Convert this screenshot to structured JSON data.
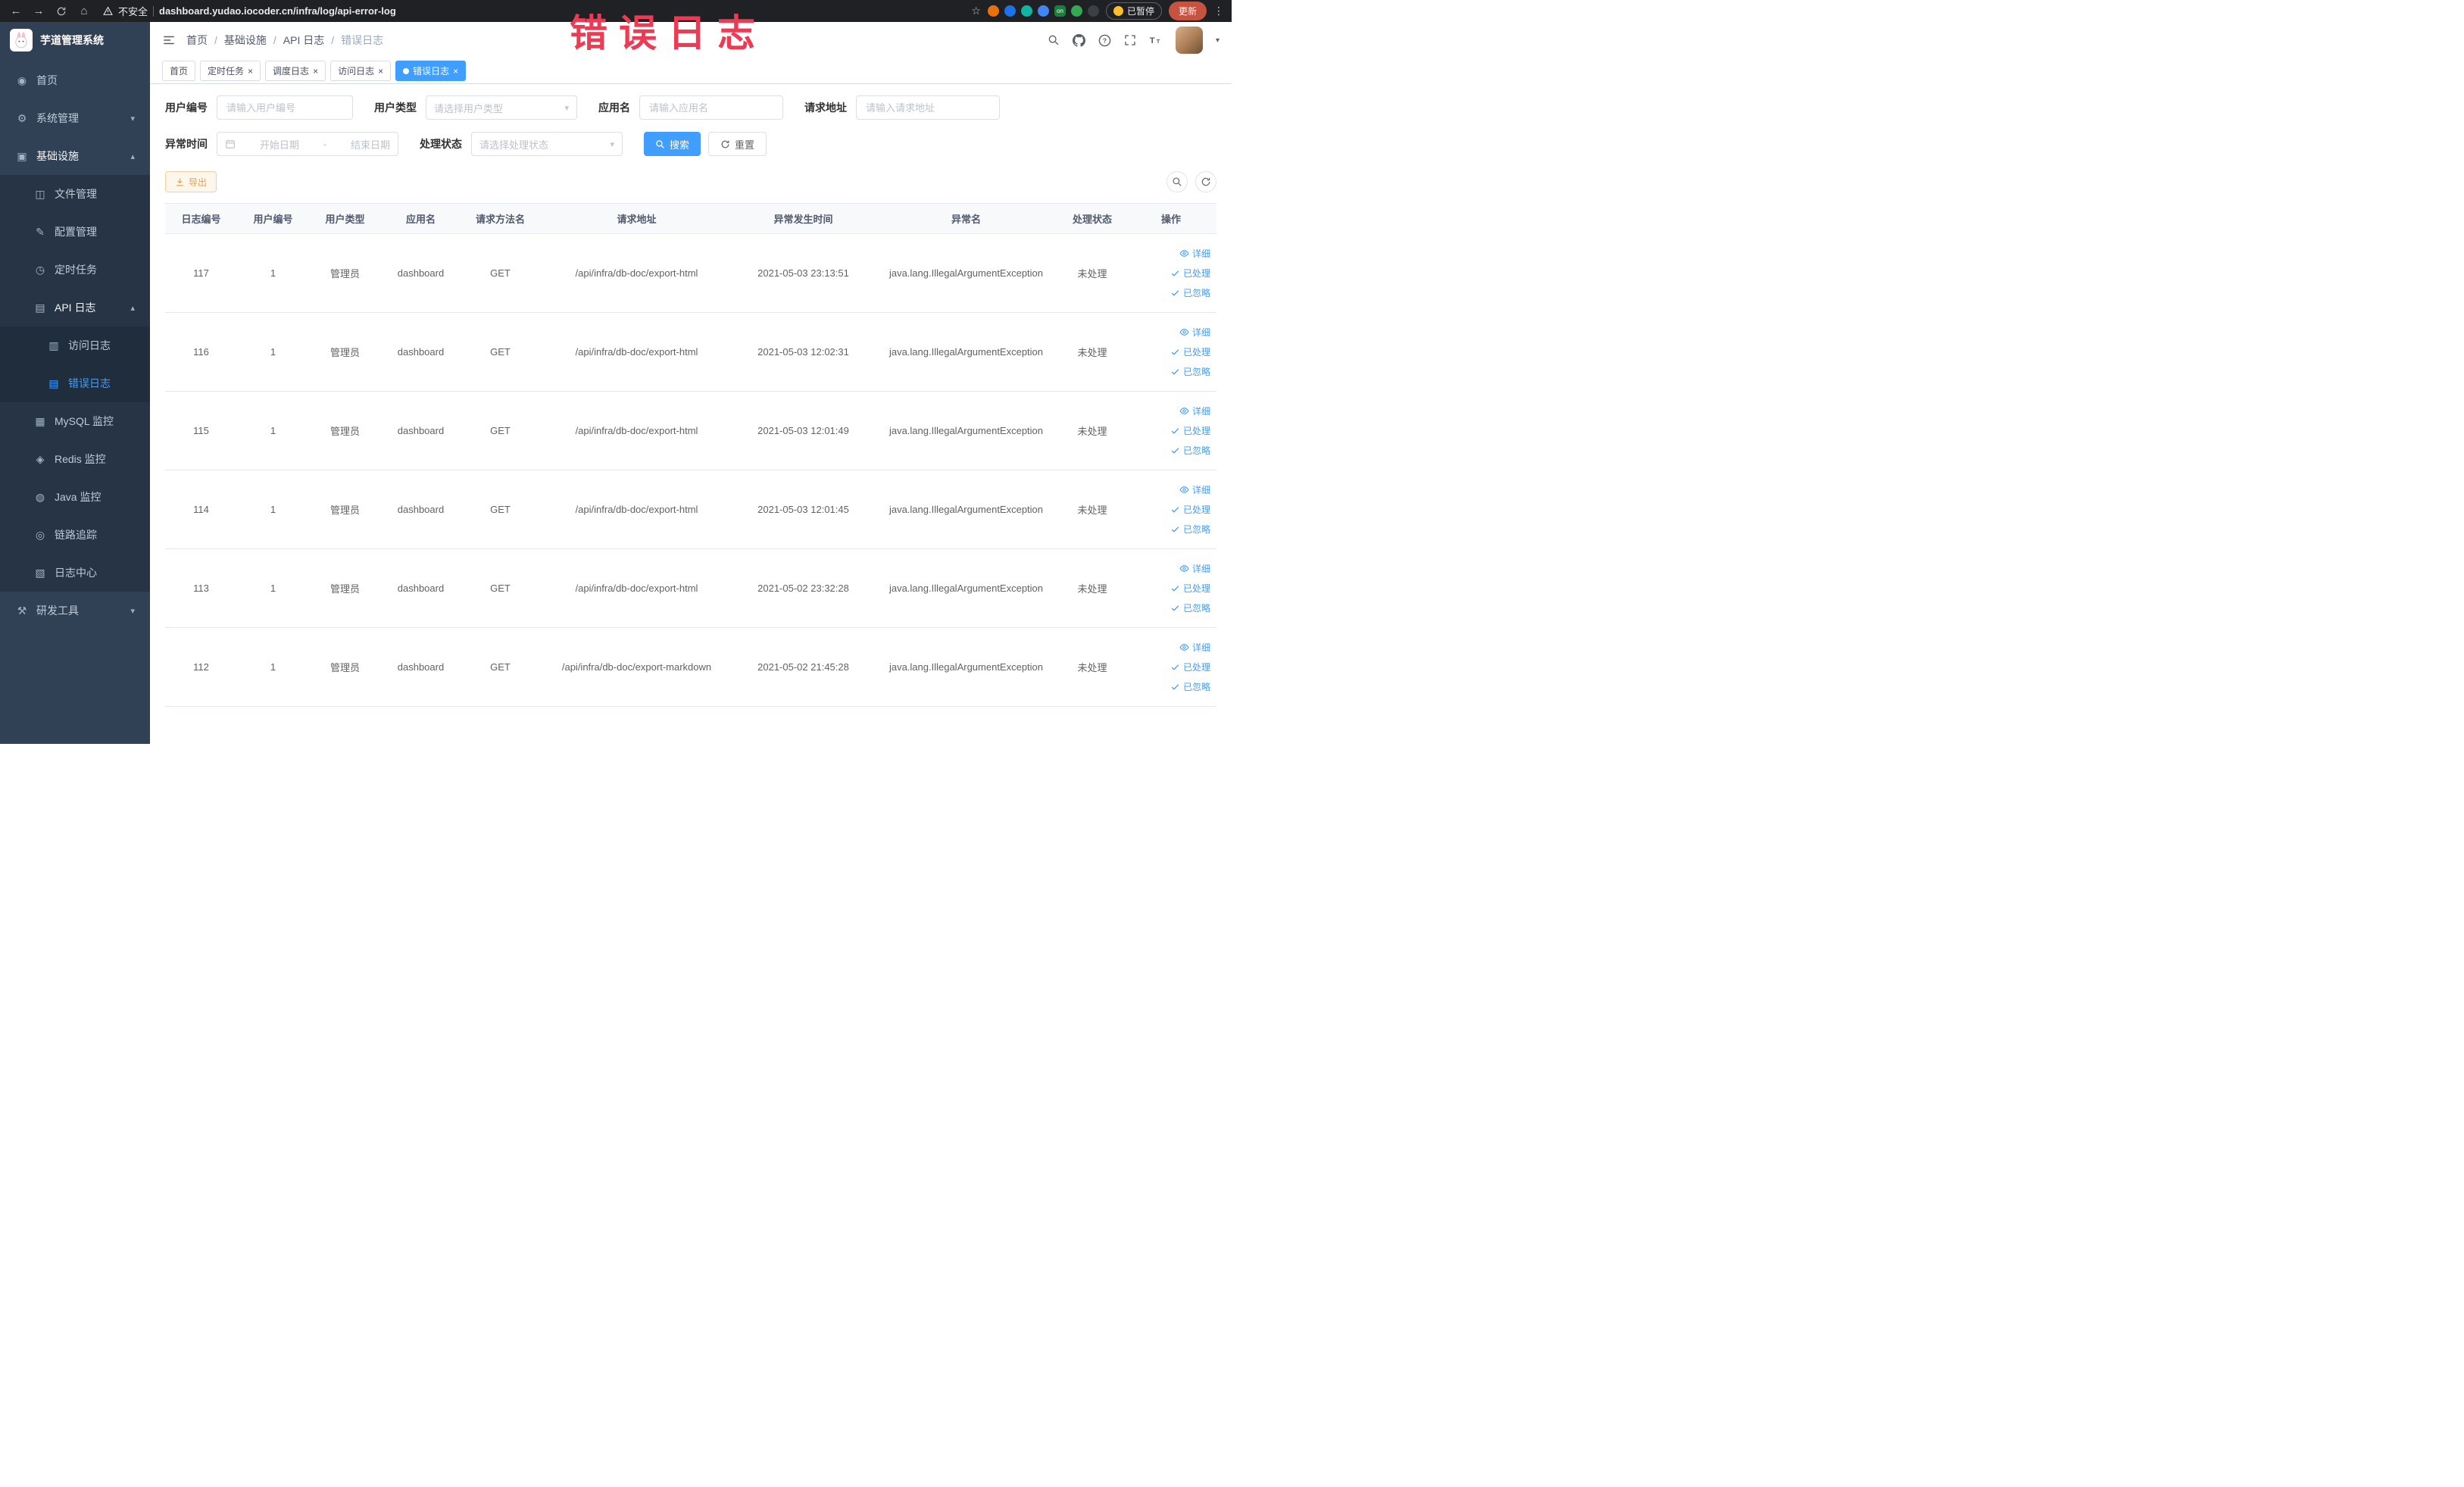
{
  "annotation": {
    "text": "错误日志"
  },
  "browser": {
    "security_label": "不安全",
    "url": "dashboard.yudao.iocoder.cn/infra/log/api-error-log",
    "paused_label": "已暂停",
    "update_label": "更新",
    "extensions": [
      {
        "name": "extension-orange-icon",
        "color": "#e8710a",
        "label": ""
      },
      {
        "name": "extension-blue-icon",
        "color": "#1a73e8",
        "label": ""
      },
      {
        "name": "extension-teal-icon",
        "color": "#12b5a5",
        "label": ""
      },
      {
        "name": "extension-grid-icon",
        "color": "#4285f4",
        "label": ""
      },
      {
        "name": "extension-on-icon",
        "color": "#188038",
        "label": "on"
      },
      {
        "name": "extension-green-icon",
        "color": "#34a853",
        "label": ""
      },
      {
        "name": "extension-dark-icon",
        "color": "#3c4043",
        "label": ""
      }
    ]
  },
  "sidebar": {
    "title": "芋道管理系统",
    "menu": [
      {
        "key": "home",
        "label": "首页",
        "level": 1,
        "icon": "home-icon"
      },
      {
        "key": "system",
        "label": "系统管理",
        "level": 1,
        "icon": "gear-icon",
        "chevron": "down"
      },
      {
        "key": "infra",
        "label": "基础设施",
        "level": 1,
        "icon": "infra-icon",
        "chevron": "up",
        "open": true
      },
      {
        "key": "file",
        "label": "文件管理",
        "level": 2,
        "icon": "file-icon"
      },
      {
        "key": "config",
        "label": "配置管理",
        "level": 2,
        "icon": "config-icon"
      },
      {
        "key": "job",
        "label": "定时任务",
        "level": 2,
        "icon": "timer-icon"
      },
      {
        "key": "api-log",
        "label": "API 日志",
        "level": 2,
        "icon": "api-log-icon",
        "chevron": "up",
        "open": true
      },
      {
        "key": "access-log",
        "label": "访问日志",
        "level": 3,
        "icon": "access-log-icon"
      },
      {
        "key": "error-log",
        "label": "错误日志",
        "level": 3,
        "icon": "error-log-icon",
        "active": true
      },
      {
        "key": "mysql",
        "label": "MySQL 监控",
        "level": 2,
        "icon": "mysql-icon"
      },
      {
        "key": "redis",
        "label": "Redis 监控",
        "level": 2,
        "icon": "redis-icon"
      },
      {
        "key": "java",
        "label": "Java 监控",
        "level": 2,
        "icon": "java-icon"
      },
      {
        "key": "trace",
        "label": "链路追踪",
        "level": 2,
        "icon": "trace-icon"
      },
      {
        "key": "log-center",
        "label": "日志中心",
        "level": 2,
        "icon": "log-center-icon"
      },
      {
        "key": "dev-tools",
        "label": "研发工具",
        "level": 1,
        "icon": "tools-icon",
        "chevron": "down"
      }
    ]
  },
  "header": {
    "breadcrumb": [
      "首页",
      "基础设施",
      "API 日志",
      "错误日志"
    ]
  },
  "tabs": [
    {
      "key": "home",
      "label": "首页"
    },
    {
      "key": "job",
      "label": "定时任务",
      "closable": true
    },
    {
      "key": "job-log",
      "label": "调度日志",
      "closable": true
    },
    {
      "key": "access-log",
      "label": "访问日志",
      "closable": true
    },
    {
      "key": "error-log",
      "label": "错误日志",
      "closable": true,
      "active": true
    }
  ],
  "filters": {
    "user_id": {
      "label": "用户编号",
      "placeholder": "请输入用户编号"
    },
    "user_type": {
      "label": "用户类型",
      "placeholder": "请选择用户类型"
    },
    "app_name": {
      "label": "应用名",
      "placeholder": "请输入应用名"
    },
    "request_url": {
      "label": "请求地址",
      "placeholder": "请输入请求地址"
    },
    "exception_time": {
      "label": "异常时间",
      "start_placeholder": "开始日期",
      "separator": "-",
      "end_placeholder": "结束日期"
    },
    "process_status": {
      "label": "处理状态",
      "placeholder": "请选择处理状态"
    },
    "search_label": "搜索",
    "reset_label": "重置"
  },
  "toolbar": {
    "export_label": "导出"
  },
  "table": {
    "columns": [
      "日志编号",
      "用户编号",
      "用户类型",
      "应用名",
      "请求方法名",
      "请求地址",
      "异常发生时间",
      "异常名",
      "处理状态",
      "操作"
    ],
    "col_keys": [
      "log-id",
      "user-id",
      "user-type",
      "app-name",
      "method",
      "request-url",
      "exception-time",
      "exception-name",
      "status",
      "actions"
    ],
    "rows": [
      [
        "117",
        "1",
        "管理员",
        "dashboard",
        "GET",
        "/api/infra/db-doc/export-html",
        "2021-05-03 23:13:51",
        "java.lang.IllegalArgumentException",
        "未处理"
      ],
      [
        "116",
        "1",
        "管理员",
        "dashboard",
        "GET",
        "/api/infra/db-doc/export-html",
        "2021-05-03 12:02:31",
        "java.lang.IllegalArgumentException",
        "未处理"
      ],
      [
        "115",
        "1",
        "管理员",
        "dashboard",
        "GET",
        "/api/infra/db-doc/export-html",
        "2021-05-03 12:01:49",
        "java.lang.IllegalArgumentException",
        "未处理"
      ],
      [
        "114",
        "1",
        "管理员",
        "dashboard",
        "GET",
        "/api/infra/db-doc/export-html",
        "2021-05-03 12:01:45",
        "java.lang.IllegalArgumentException",
        "未处理"
      ],
      [
        "113",
        "1",
        "管理员",
        "dashboard",
        "GET",
        "/api/infra/db-doc/export-html",
        "2021-05-02 23:32:28",
        "java.lang.IllegalArgumentException",
        "未处理"
      ],
      [
        "112",
        "1",
        "管理员",
        "dashboard",
        "GET",
        "/api/infra/db-doc/export-markdown",
        "2021-05-02 21:45:28",
        "java.lang.IllegalArgumentException",
        "未处理"
      ]
    ],
    "actions": [
      {
        "key": "detail",
        "label": "详细"
      },
      {
        "key": "processed",
        "label": "已处理"
      },
      {
        "key": "ignored",
        "label": "已忽略"
      }
    ]
  },
  "colors": {
    "accent": "#409eff",
    "annotation": "#ee3b55",
    "warning": "#e6a23c"
  }
}
